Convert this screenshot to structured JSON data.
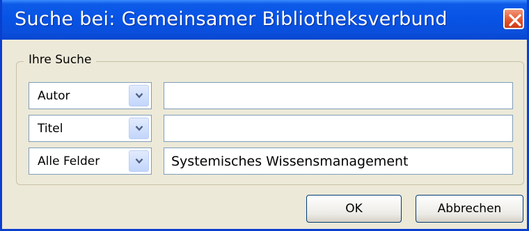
{
  "window": {
    "title": "Suche bei: Gemeinsamer Bibliotheksverbund",
    "close_icon": "close-icon",
    "colors": {
      "titlebar": "#0753e6",
      "close": "#e3572f",
      "face": "#ece9d8"
    }
  },
  "group": {
    "legend": "Ihre Suche",
    "rows": [
      {
        "field": "Autor",
        "value": ""
      },
      {
        "field": "Titel",
        "value": ""
      },
      {
        "field": "Alle Felder",
        "value": "Systemisches Wissensmanagement"
      }
    ]
  },
  "buttons": {
    "ok": "OK",
    "cancel": "Abbrechen"
  }
}
